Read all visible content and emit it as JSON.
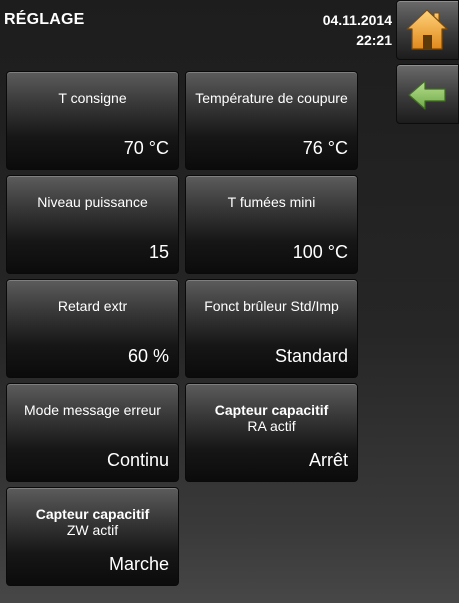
{
  "header": {
    "title": "RÉGLAGE",
    "date": "04.11.2014",
    "time": "22:21"
  },
  "nav": {
    "home_icon": "home-icon",
    "back_icon": "arrow-left-icon",
    "home_color": "#f0a840",
    "back_color": "#8cc06a"
  },
  "tiles": [
    {
      "label": "T consigne",
      "value": "70 °C"
    },
    {
      "label": "Température de coupure",
      "value": "76 °C"
    },
    {
      "label": "Niveau puissance",
      "value": "15"
    },
    {
      "label": "T fumées mini",
      "value": "100 °C"
    },
    {
      "label": "Retard extr",
      "value": "60 %"
    },
    {
      "label": "Fonct brûleur Std/Imp",
      "value": "Standard"
    },
    {
      "label": "Mode message erreur",
      "value": "Continu"
    },
    {
      "label_bold": "Capteur capacitif",
      "label_sub": "RA actif",
      "value": "Arrêt"
    },
    {
      "label_bold": "Capteur capacitif",
      "label_sub": "ZW actif",
      "value": "Marche"
    }
  ]
}
